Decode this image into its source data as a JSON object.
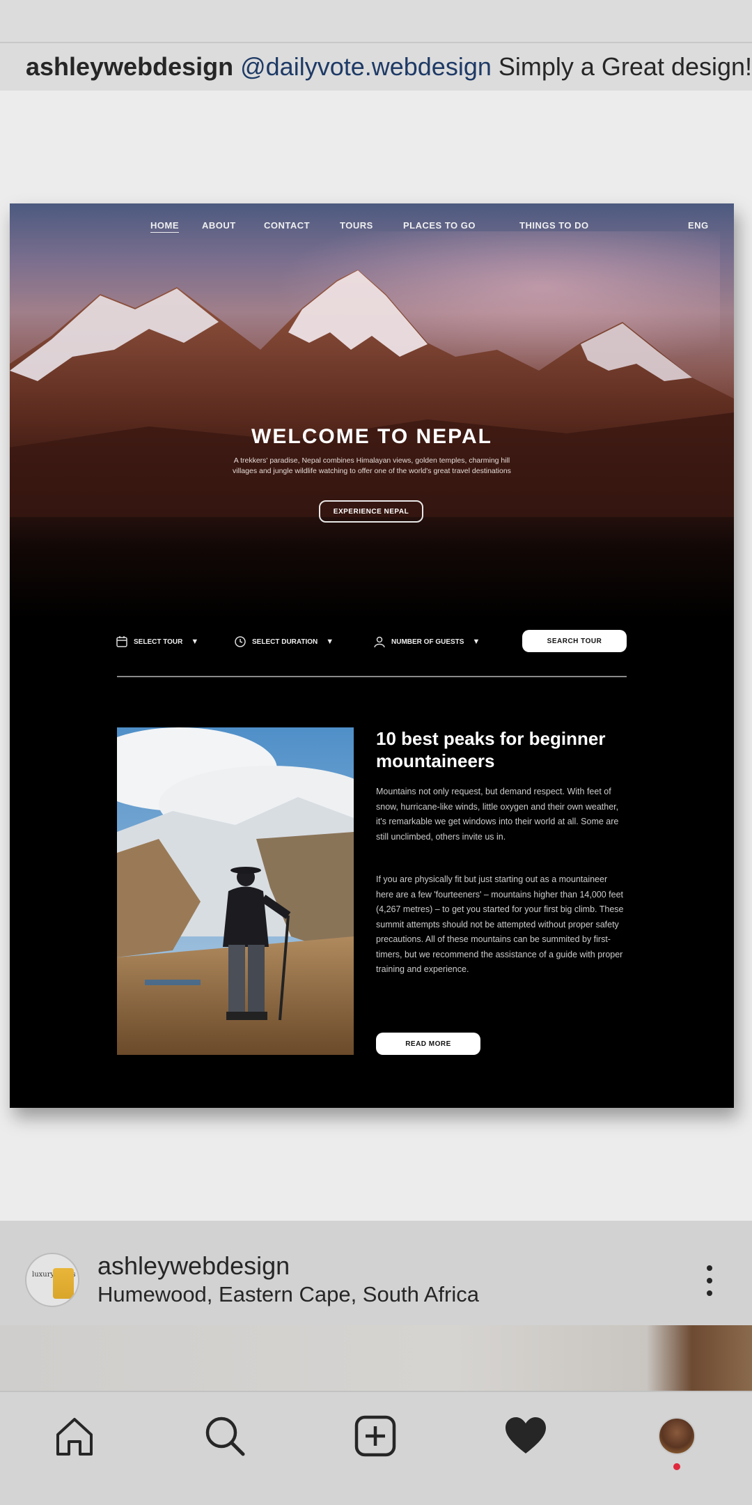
{
  "caption": {
    "username": "ashleywebdesign",
    "mention": "@dailyvote.webdesign",
    "text": "Simply a Great design!"
  },
  "mockup": {
    "nav": [
      "HOME",
      "ABOUT",
      "CONTACT",
      "TOURS",
      "PLACES TO GO",
      "THINGS TO DO"
    ],
    "lang": "ENG",
    "hero": {
      "title": "WELCOME TO NEPAL",
      "subtitle": "A trekkers' paradise, Nepal combines Himalayan views, golden temples, charming hill villages and jungle wildlife watching to offer one of the world's great travel destinations",
      "button": "EXPERIENCE NEPAL"
    },
    "search": {
      "tour": "SELECT TOUR",
      "duration": "SELECT DURATION",
      "guests": "NUMBER OF GUESTS",
      "caret": "▼",
      "button": "SEARCH TOUR"
    },
    "article": {
      "title": "10 best peaks for beginner mountaineers",
      "p1": "Mountains not only request, but demand respect. With feet of snow, hurricane-like winds, little oxygen and their own weather, it's remarkable we get windows into their world at all. Some are still unclimbed, others invite us in.",
      "p2": "If you are physically fit but just starting out as a mountaineer here are a few 'fourteeners' – mountains higher than 14,000 feet (4,267 metres) – to get you started for your first big climb. These summit attempts should not be attempted without proper safety precautions. All of these mountains can be summited by first-timers, but we recommend the assistance of a guide with proper training and experience.",
      "button": "READ MORE"
    }
  },
  "post": {
    "username": "ashleywebdesign",
    "location": "Humewood, Eastern Cape, South Africa",
    "avatar_text": "luxury dress"
  },
  "bottom_nav": [
    "home-icon",
    "search-icon",
    "add-post-icon",
    "heart-icon",
    "profile-avatar"
  ],
  "colors": {
    "mention": "#1e3a66",
    "notification_dot": "#e0283c"
  }
}
